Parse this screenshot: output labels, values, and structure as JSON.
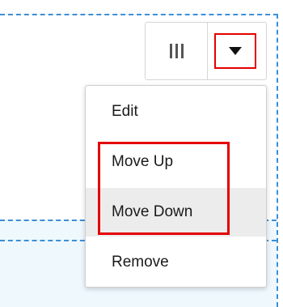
{
  "toolbar": {
    "handle_icon": "drag-handle-icon",
    "dropdown_icon": "caret-down-icon"
  },
  "menu": {
    "items": [
      {
        "label": "Edit"
      },
      {
        "label": "Move Up"
      },
      {
        "label": "Move Down",
        "state": "hover"
      },
      {
        "label": "Remove"
      }
    ]
  },
  "colors": {
    "accent_dashed": "#3d8fd6",
    "highlight_red": "#e30000",
    "hover_bg": "#ececec",
    "region_bg": "#eef8fd"
  }
}
